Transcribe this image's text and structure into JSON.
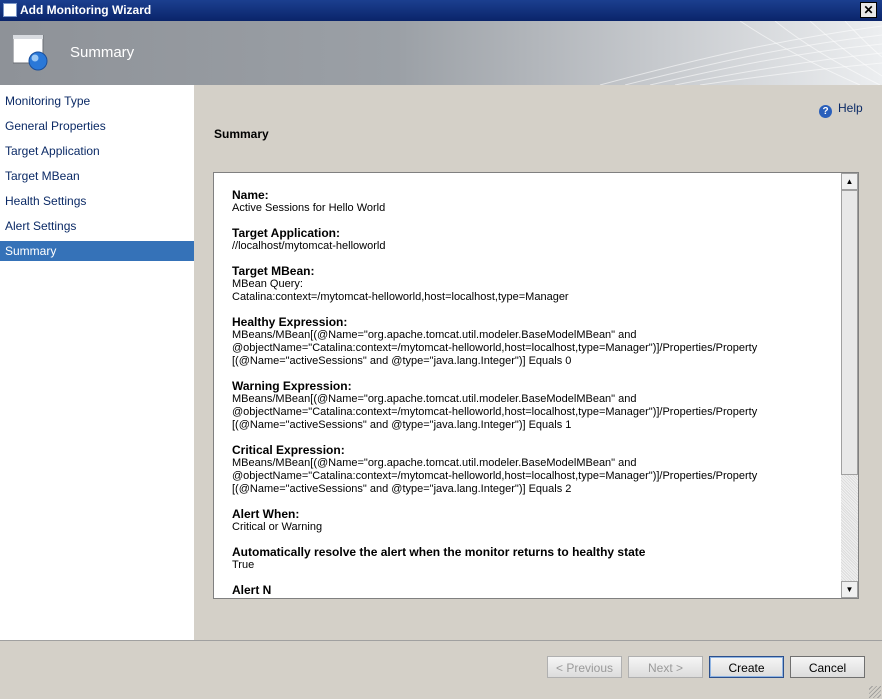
{
  "window": {
    "title": "Add Monitoring Wizard",
    "close_glyph": "✕"
  },
  "banner": {
    "heading": "Summary"
  },
  "sidebar": {
    "items": [
      {
        "label": "Monitoring Type"
      },
      {
        "label": "General Properties"
      },
      {
        "label": "Target Application"
      },
      {
        "label": "Target MBean"
      },
      {
        "label": "Health Settings"
      },
      {
        "label": "Alert Settings"
      },
      {
        "label": "Summary"
      }
    ],
    "active_index": 6
  },
  "help": {
    "label": "Help",
    "icon": "help-icon"
  },
  "main": {
    "section_title": "Summary"
  },
  "summary": {
    "fields": [
      {
        "label": "Name:",
        "value": "Active Sessions for Hello World"
      },
      {
        "label": "Target Application:",
        "value": "//localhost/mytomcat-helloworld"
      },
      {
        "label": "Target MBean:",
        "value": "MBean Query:\nCatalina:context=/mytomcat-helloworld,host=localhost,type=Manager"
      },
      {
        "label": "Healthy Expression:",
        "value": "MBeans/MBean[(@Name=\"org.apache.tomcat.util.modeler.BaseModelMBean\" and\n@objectName=\"Catalina:context=/mytomcat-helloworld,host=localhost,type=Manager\")]/Properties/Property\n[(@Name=\"activeSessions\" and @type=\"java.lang.Integer\")] Equals 0"
      },
      {
        "label": "Warning Expression:",
        "value": "MBeans/MBean[(@Name=\"org.apache.tomcat.util.modeler.BaseModelMBean\" and\n@objectName=\"Catalina:context=/mytomcat-helloworld,host=localhost,type=Manager\")]/Properties/Property\n[(@Name=\"activeSessions\" and @type=\"java.lang.Integer\")] Equals 1"
      },
      {
        "label": "Critical Expression:",
        "value": "MBeans/MBean[(@Name=\"org.apache.tomcat.util.modeler.BaseModelMBean\" and\n@objectName=\"Catalina:context=/mytomcat-helloworld,host=localhost,type=Manager\")]/Properties/Property\n[(@Name=\"activeSessions\" and @type=\"java.lang.Integer\")] Equals 2"
      },
      {
        "label": "Alert When:",
        "value": "Critical or Warning"
      },
      {
        "label": "Automatically resolve the alert when the monitor returns to healthy state",
        "value": "True"
      },
      {
        "label": "Alert N",
        "value": ""
      }
    ]
  },
  "buttons": {
    "previous": "< Previous",
    "next": "Next >",
    "create": "Create",
    "cancel": "Cancel"
  },
  "colors": {
    "title_bar": "#0a246a",
    "selected_nav": "#3572b8",
    "nav_text": "#0b2a66"
  }
}
